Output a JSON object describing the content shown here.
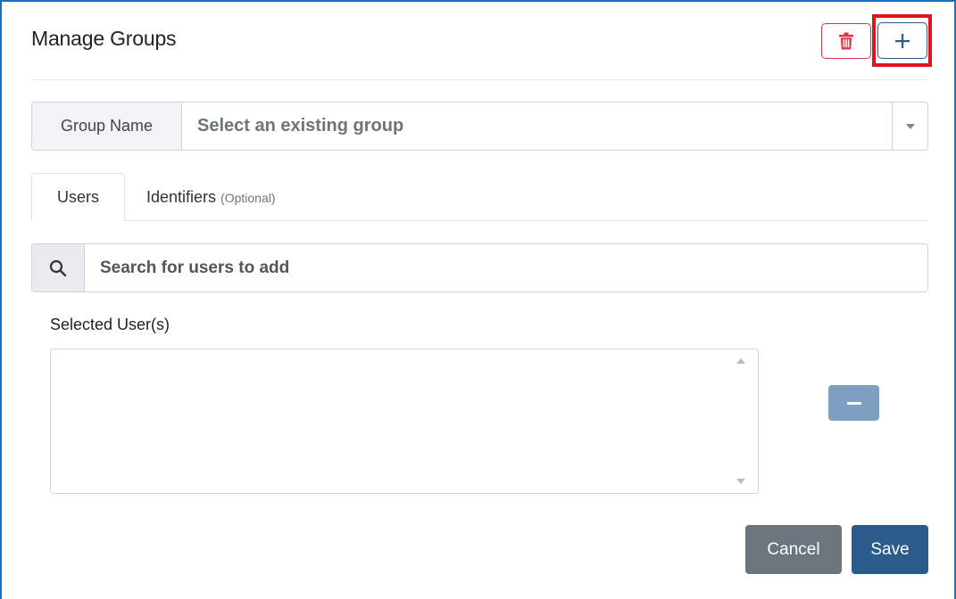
{
  "dialog": {
    "title": "Manage Groups"
  },
  "header_actions": {
    "delete_icon": "trash-icon",
    "add_icon": "plus-icon",
    "delete_color": "#dc3545",
    "add_color": "#2b5b8a",
    "highlight_color": "#e0131f"
  },
  "group": {
    "label": "Group Name",
    "placeholder": "Select an existing group"
  },
  "tabs": [
    {
      "label": "Users",
      "suffix": ""
    },
    {
      "label": "Identifiers",
      "suffix": "(Optional)"
    }
  ],
  "search": {
    "icon": "search-icon",
    "placeholder": "Search for users to add"
  },
  "selected_users": {
    "label": "Selected User(s)",
    "items": []
  },
  "footer": {
    "cancel_label": "Cancel",
    "save_label": "Save"
  }
}
